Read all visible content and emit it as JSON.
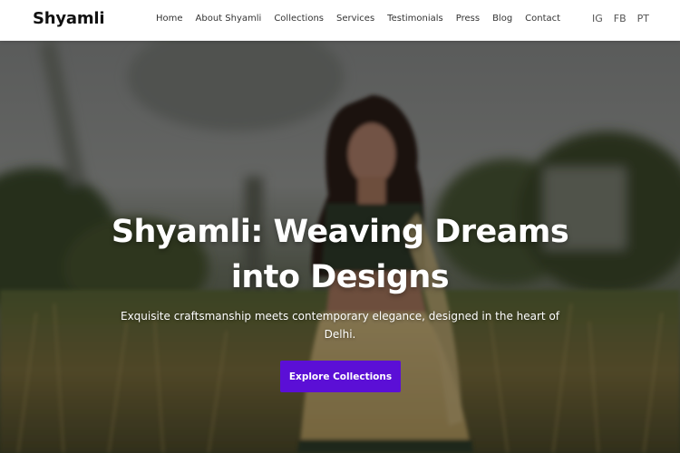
{
  "brand": "Shyamli",
  "nav": {
    "items": [
      {
        "label": "Home"
      },
      {
        "label": "About Shyamli"
      },
      {
        "label": "Collections"
      },
      {
        "label": "Services"
      },
      {
        "label": "Testimonials"
      },
      {
        "label": "Press"
      },
      {
        "label": "Blog"
      },
      {
        "label": "Contact"
      }
    ]
  },
  "social": {
    "items": [
      {
        "label": "IG"
      },
      {
        "label": "FB"
      },
      {
        "label": "PT"
      }
    ]
  },
  "hero": {
    "title": "Shyamli: Weaving Dreams into Designs",
    "subtitle": "Exquisite craftsmanship meets contemporary elegance, designed in the heart of Delhi.",
    "cta_label": "Explore Collections",
    "image": "woman-in-lehenga-in-field-photo"
  },
  "colors": {
    "accent": "#5b0fd6",
    "nav_bg": "#ffffff",
    "text_dark": "#111111"
  }
}
